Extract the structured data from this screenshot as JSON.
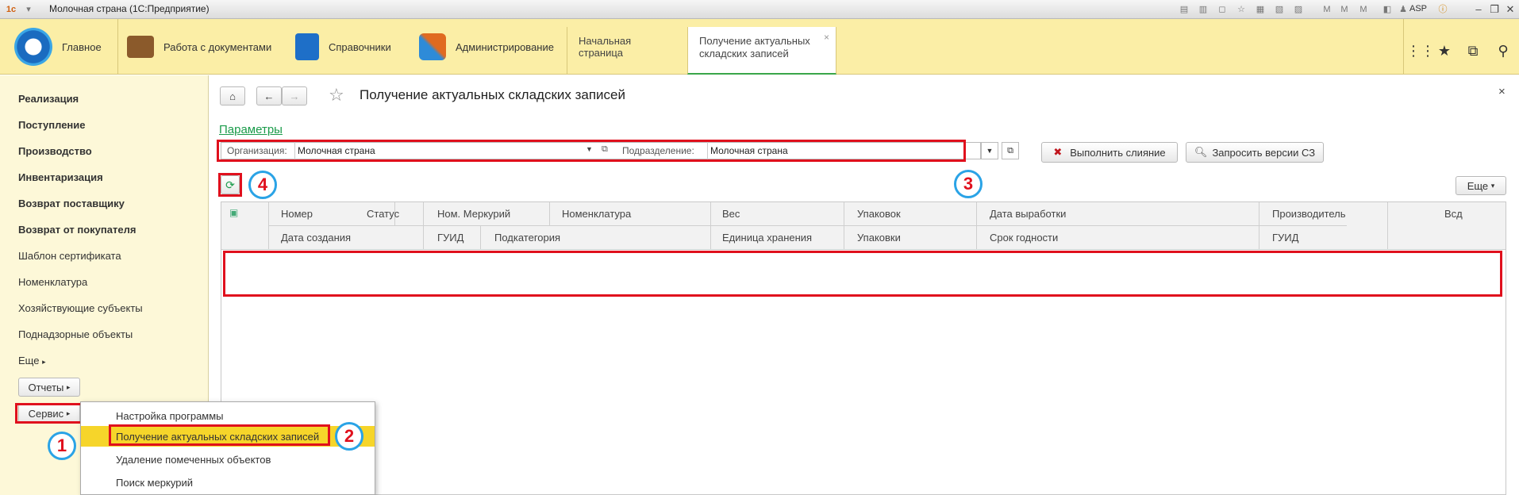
{
  "window": {
    "title": "Молочная страна  (1С:Предприятие)",
    "user": "ASP"
  },
  "sections": [
    {
      "label": "Главное"
    },
    {
      "label": "Работа с документами"
    },
    {
      "label": "Справочники"
    },
    {
      "label": "Администрирование"
    }
  ],
  "open_tabs": [
    {
      "label": "Начальная страница"
    },
    {
      "label": "Получение актуальных складских записей"
    }
  ],
  "tab_close": "×",
  "nav": {
    "items": [
      {
        "label": "Реализация",
        "bold": true
      },
      {
        "label": "Поступление",
        "bold": true
      },
      {
        "label": "Производство",
        "bold": true
      },
      {
        "label": "Инвентаризация",
        "bold": true
      },
      {
        "label": "Возврат поставщику",
        "bold": true
      },
      {
        "label": "Возврат от покупателя",
        "bold": true
      },
      {
        "label": "Шаблон сертификата",
        "bold": false
      },
      {
        "label": "Номенклатура",
        "bold": false
      },
      {
        "label": "Хозяйствующие субъекты",
        "bold": false
      },
      {
        "label": "Поднадзорные объекты",
        "bold": false
      },
      {
        "label": "Еще",
        "bold": false
      }
    ],
    "reports_label": "Отчеты",
    "service_label": "Сервис"
  },
  "page": {
    "title": "Получение актуальных складских записей",
    "params_link": "Параметры",
    "org_label": "Организация:",
    "org_value": "Молочная страна",
    "dept_label": "Подразделение:",
    "dept_value": "Молочная страна",
    "merge_button": "Выполнить слияние",
    "request_button": "Запросить версии СЗ",
    "more_button": "Еще",
    "close": "×"
  },
  "table": {
    "row1": [
      "Номер",
      "Статус",
      "Ном. Меркурий",
      "Номенклатура",
      "Вес",
      "Упаковок",
      "Дата выработки",
      "Производитель",
      "Всд"
    ],
    "row2": [
      "Дата создания",
      "ГУИД",
      "Подкатегория",
      "Единица хранения",
      "Упаковки",
      "Срок годности",
      "ГУИД"
    ]
  },
  "popup_menu": [
    {
      "label": "Настройка программы"
    },
    {
      "label": "Получение актуальных складских записей",
      "selected": true
    },
    {
      "label": "Удаление помеченных объектов"
    },
    {
      "label": "Поиск меркурий"
    }
  ],
  "annotations": [
    "1",
    "2",
    "3",
    "4"
  ],
  "colors": {
    "section_bg": "#fbeea6",
    "nav_bg": "#fdf8d8",
    "highlight": "#f6d52a",
    "annotation_red": "#e0101d",
    "annotation_blue": "#2aa3e6",
    "link_green": "#1a9b4a"
  }
}
